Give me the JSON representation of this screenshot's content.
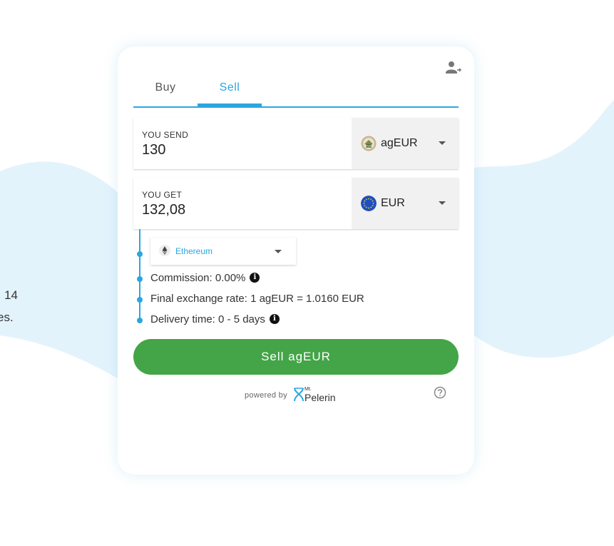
{
  "background": {
    "line1": "14",
    "line2": "es."
  },
  "tabs": [
    {
      "label": "Buy",
      "active": false
    },
    {
      "label": "Sell",
      "active": true
    }
  ],
  "send": {
    "label": "YOU SEND",
    "value": "130",
    "currency": "agEUR",
    "currency_icon": "ageur-token-icon"
  },
  "get": {
    "label": "YOU GET",
    "value": "132,08",
    "currency": "EUR",
    "currency_icon": "eu-flag-icon"
  },
  "network": {
    "name": "Ethereum",
    "icon": "ethereum-icon"
  },
  "details": {
    "commission": "Commission: 0.00%",
    "rate": "Final exchange rate: 1 agEUR = 1.0160 EUR",
    "delivery": "Delivery time: 0 - 5 days"
  },
  "action": {
    "label": "Sell agEUR"
  },
  "footer": {
    "powered_by": "powered by",
    "brand_top": "Mt.",
    "brand": "Pelerin"
  },
  "colors": {
    "accent": "#2aa7e0",
    "button": "#43a547",
    "wave": "#e3f3fc"
  }
}
